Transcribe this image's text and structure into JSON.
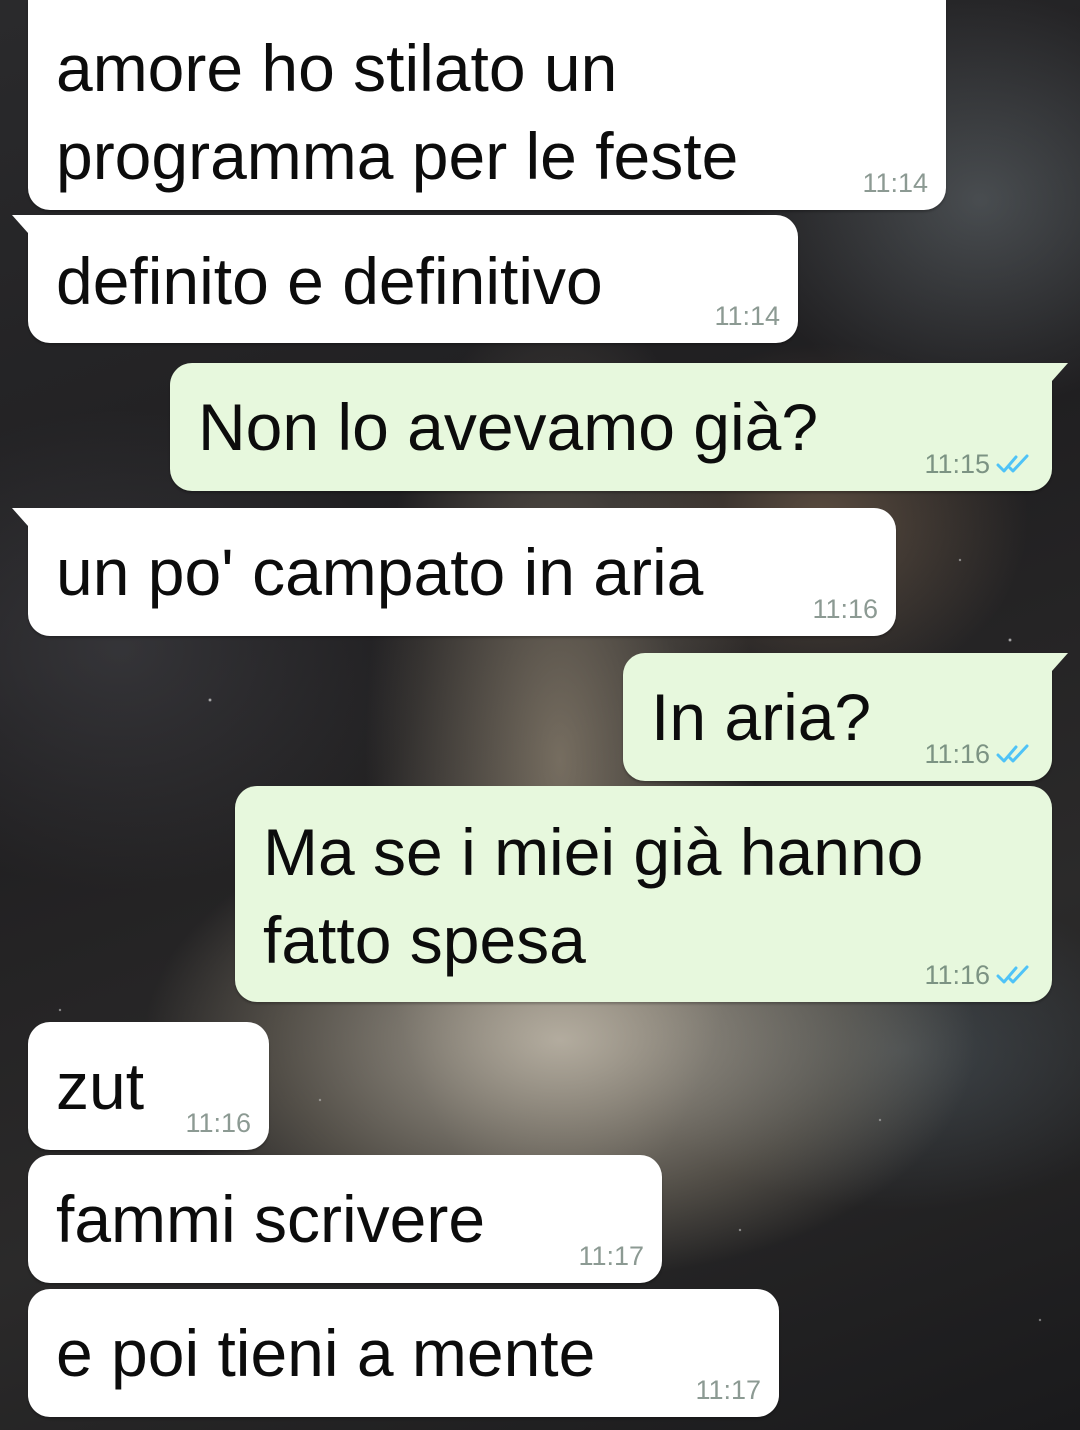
{
  "colors": {
    "incoming_bubble": "#ffffff",
    "outgoing_bubble": "#e7f8dd",
    "timestamp": "#8c9a93",
    "read_ticks": "#4fc3f7"
  },
  "messages": [
    {
      "direction": "incoming",
      "text_lines": [
        "amore ho stilato un",
        "programma per le feste"
      ],
      "time": "11:14"
    },
    {
      "direction": "incoming",
      "text_lines": [
        "definito e definitivo"
      ],
      "time": "11:14"
    },
    {
      "direction": "outgoing",
      "text_lines": [
        "Non lo avevamo già?"
      ],
      "time": "11:15",
      "status_icon": "double-check-icon"
    },
    {
      "direction": "incoming",
      "text_lines": [
        "un po' campato in aria"
      ],
      "time": "11:16"
    },
    {
      "direction": "outgoing",
      "text_lines": [
        "In aria?"
      ],
      "time": "11:16",
      "status_icon": "double-check-icon"
    },
    {
      "direction": "outgoing",
      "text_lines": [
        "Ma se i miei già hanno",
        "fatto spesa"
      ],
      "time": "11:16",
      "status_icon": "double-check-icon"
    },
    {
      "direction": "incoming",
      "text_lines": [
        "zut"
      ],
      "time": "11:16"
    },
    {
      "direction": "incoming",
      "text_lines": [
        "fammi scrivere"
      ],
      "time": "11:17"
    },
    {
      "direction": "incoming",
      "text_lines": [
        "e poi tieni a mente"
      ],
      "time": "11:17"
    }
  ]
}
